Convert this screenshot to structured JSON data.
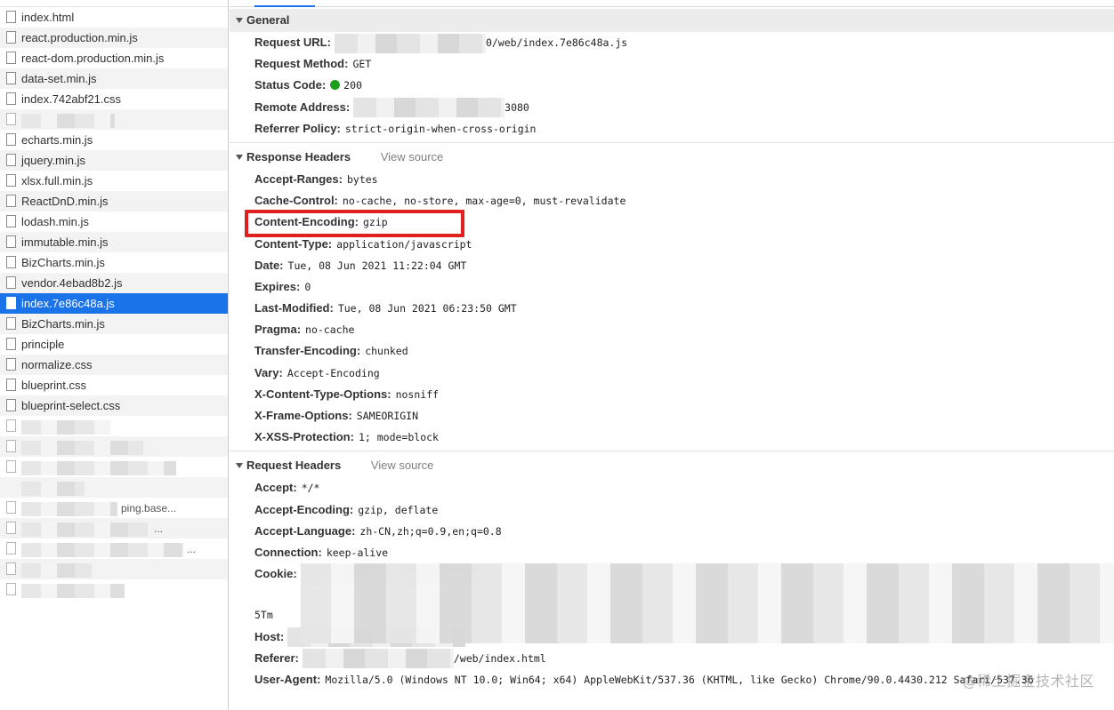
{
  "file_list": {
    "files": [
      {
        "name": "index.html",
        "selected": false
      },
      {
        "name": "react.production.min.js",
        "selected": false
      },
      {
        "name": "react-dom.production.min.js",
        "selected": false
      },
      {
        "name": "data-set.min.js",
        "selected": false
      },
      {
        "name": "index.742abf21.css",
        "selected": false
      },
      {
        "name": "",
        "selected": false,
        "blurred": true
      },
      {
        "name": "echarts.min.js",
        "selected": false
      },
      {
        "name": "jquery.min.js",
        "selected": false
      },
      {
        "name": "xlsx.full.min.js",
        "selected": false
      },
      {
        "name": "ReactDnD.min.js",
        "selected": false
      },
      {
        "name": "lodash.min.js",
        "selected": false
      },
      {
        "name": "immutable.min.js",
        "selected": false
      },
      {
        "name": "BizCharts.min.js",
        "selected": false
      },
      {
        "name": "vendor.4ebad8b2.js",
        "selected": false
      },
      {
        "name": "index.7e86c48a.js",
        "selected": true
      },
      {
        "name": "BizCharts.min.js",
        "selected": false
      },
      {
        "name": "principle",
        "selected": false
      },
      {
        "name": "normalize.css",
        "selected": false
      },
      {
        "name": "blueprint.css",
        "selected": false
      },
      {
        "name": "blueprint-select.css",
        "selected": false
      },
      {
        "name": "",
        "selected": false,
        "blurred": true
      },
      {
        "name": "",
        "selected": false,
        "blurred": true
      },
      {
        "name": "",
        "selected": false,
        "blurred": true
      },
      {
        "name": "",
        "selected": false,
        "blurred": true,
        "noicon": true
      },
      {
        "name": "",
        "selected": false,
        "blurred": true,
        "tail": "ping.base..."
      },
      {
        "name": "",
        "selected": false,
        "blurred": true,
        "tail": "..."
      },
      {
        "name": "",
        "selected": false,
        "blurred": true,
        "tail": "..."
      },
      {
        "name": "",
        "selected": false,
        "blurred": true
      },
      {
        "name": "",
        "selected": false,
        "blurred": true
      }
    ]
  },
  "general": {
    "title": "General",
    "rows": [
      {
        "name": "Request URL:",
        "value": "0/web/index.7e86c48a.js",
        "redacted_prefix": true
      },
      {
        "name": "Request Method:",
        "value": "GET"
      },
      {
        "name": "Status Code:",
        "value": "200",
        "status_dot": true
      },
      {
        "name": "Remote Address:",
        "value": "3080",
        "redacted_prefix": true
      },
      {
        "name": "Referrer Policy:",
        "value": "strict-origin-when-cross-origin"
      }
    ]
  },
  "response_headers": {
    "title": "Response Headers",
    "view_source": "View source",
    "rows": [
      {
        "name": "Accept-Ranges:",
        "value": "bytes"
      },
      {
        "name": "Cache-Control:",
        "value": "no-cache, no-store, max-age=0, must-revalidate"
      },
      {
        "name": "Content-Encoding:",
        "value": "gzip",
        "highlighted": true
      },
      {
        "name": "Content-Type:",
        "value": "application/javascript"
      },
      {
        "name": "Date:",
        "value": "Tue, 08 Jun 2021 11:22:04 GMT"
      },
      {
        "name": "Expires:",
        "value": "0"
      },
      {
        "name": "Last-Modified:",
        "value": "Tue, 08 Jun 2021 06:23:50 GMT"
      },
      {
        "name": "Pragma:",
        "value": "no-cache"
      },
      {
        "name": "Transfer-Encoding:",
        "value": "chunked"
      },
      {
        "name": "Vary:",
        "value": "Accept-Encoding"
      },
      {
        "name": "X-Content-Type-Options:",
        "value": "nosniff"
      },
      {
        "name": "X-Frame-Options:",
        "value": "SAMEORIGIN"
      },
      {
        "name": "X-XSS-Protection:",
        "value": "1; mode=block"
      }
    ]
  },
  "request_headers": {
    "title": "Request Headers",
    "view_source": "View source",
    "rows": [
      {
        "name": "Accept:",
        "value": "*/*"
      },
      {
        "name": "Accept-Encoding:",
        "value": "gzip, deflate"
      },
      {
        "name": "Accept-Language:",
        "value": "zh-CN,zh;q=0.9,en;q=0.8"
      },
      {
        "name": "Connection:",
        "value": "keep-alive"
      },
      {
        "name": "Cookie:",
        "value": "",
        "redacted_prefix": true
      },
      {
        "name": "",
        "value": "5Tm",
        "continuation": true
      },
      {
        "name": "Host:",
        "value": "",
        "redacted_prefix": true
      },
      {
        "name": "Referer:",
        "value": "/web/index.html",
        "redacted_prefix": true
      },
      {
        "name": "User-Agent:",
        "value": "Mozilla/5.0 (Windows NT 10.0; Win64; x64) AppleWebKit/537.36 (KHTML, like Gecko) Chrome/90.0.4430.212 Safari/537.36"
      }
    ]
  },
  "watermark": "@稀土掘金技术社区",
  "colors": {
    "selected_row": "#1a73e8",
    "highlight_box": "#e0201e",
    "status_ok": "#1e9e1e"
  },
  "icons": {
    "file": "file-icon",
    "section_toggle": "triangle-down-icon",
    "status": "green-dot-icon"
  }
}
